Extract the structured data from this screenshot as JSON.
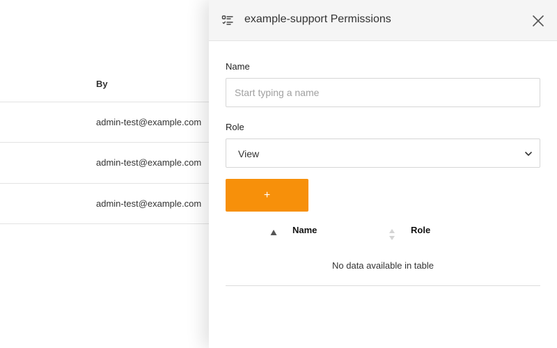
{
  "background": {
    "column_header": "By",
    "rows": [
      {
        "by": "admin-test@example.com"
      },
      {
        "by": "admin-test@example.com"
      },
      {
        "by": "admin-test@example.com"
      }
    ]
  },
  "panel": {
    "title": "example-support Permissions",
    "icon": "list-checks-icon",
    "close_icon": "close-icon",
    "name_label": "Name",
    "name_placeholder": "Start typing a name",
    "name_value": "",
    "role_label": "Role",
    "role_value": "View",
    "add_label": "+",
    "accent_color": "#f7900a",
    "table": {
      "columns": [
        "Name",
        "Role"
      ],
      "empty_message": "No data available in table"
    }
  }
}
